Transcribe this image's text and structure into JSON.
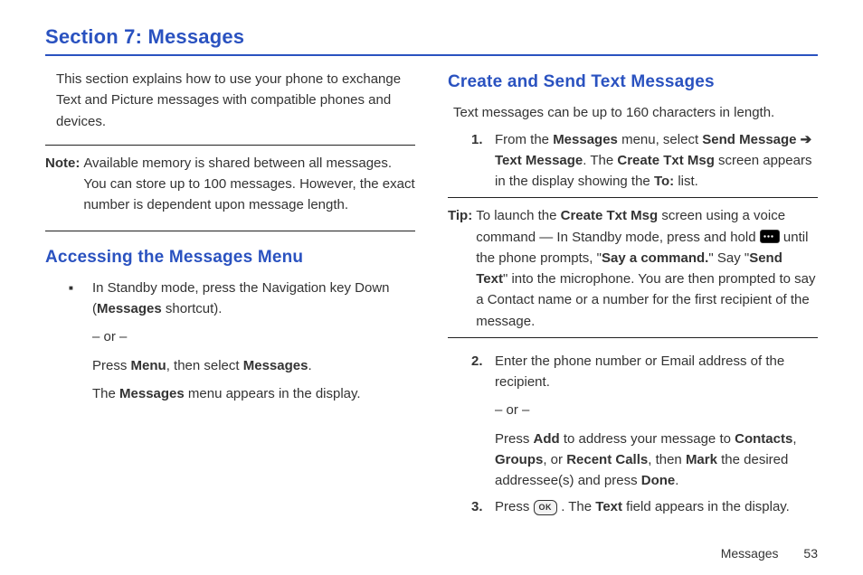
{
  "section_title": "Section 7: Messages",
  "intro": "This section explains how to use your phone to exchange Text and Picture messages with compatible phones and devices.",
  "note": {
    "label": "Note:",
    "text": "Available memory is shared between all messages. You can store up to 100 messages. However, the exact number is dependent upon message length."
  },
  "left": {
    "heading": "Accessing the Messages Menu",
    "bullet": {
      "line1_a": "In Standby mode, press the Navigation key Down (",
      "line1_bold": "Messages",
      "line1_b": " shortcut).",
      "or": "– or –",
      "line2_a": "Press ",
      "line2_bold1": "Menu",
      "line2_b": ", then select ",
      "line2_bold2": "Messages",
      "line2_c": ".",
      "line3_a": "The ",
      "line3_bold": "Messages",
      "line3_b": " menu appears in the display."
    }
  },
  "right": {
    "heading": "Create and Send Text Messages",
    "intro": "Text messages can be up to 160 characters in length.",
    "step1": {
      "num": "1.",
      "a": "From the ",
      "b1": "Messages",
      "b": " menu, select ",
      "b2": "Send Message",
      "arrow": " ➔ ",
      "b3": "Text Message",
      "c": ". The ",
      "b4": "Create Txt Msg",
      "d": " screen appears in the display showing the ",
      "b5": "To:",
      "e": " list."
    },
    "tip": {
      "label": "Tip:",
      "a": "To launch the ",
      "b1": "Create Txt Msg",
      "b": " screen using a voice command — In Standby mode, press and hold ",
      "c": " until the phone prompts, \"",
      "b2": "Say a command.",
      "d": "\" Say \"",
      "b3": "Send Text",
      "e": "\" into the microphone. You are then prompted to say a Contact name or a number for the first recipient of the message."
    },
    "step2": {
      "num": "2.",
      "a": "Enter the phone number or Email address of the recipient.",
      "or": "– or –",
      "b_a": "Press ",
      "b_b1": "Add",
      "b_b": " to address your message to ",
      "b_b2": "Contacts",
      "b_c": ", ",
      "b_b3": "Groups",
      "b_d": ", or ",
      "b_b4": "Recent Calls",
      "b_e": ", then ",
      "b_b5": "Mark",
      "b_f": " the desired addressee(s) and press ",
      "b_b6": "Done",
      "b_g": "."
    },
    "step3": {
      "num": "3.",
      "a": "Press ",
      "ok": "OK",
      "b": ". The ",
      "b1": "Text",
      "c": " field appears in the display."
    }
  },
  "footer": {
    "label": "Messages",
    "page": "53"
  }
}
